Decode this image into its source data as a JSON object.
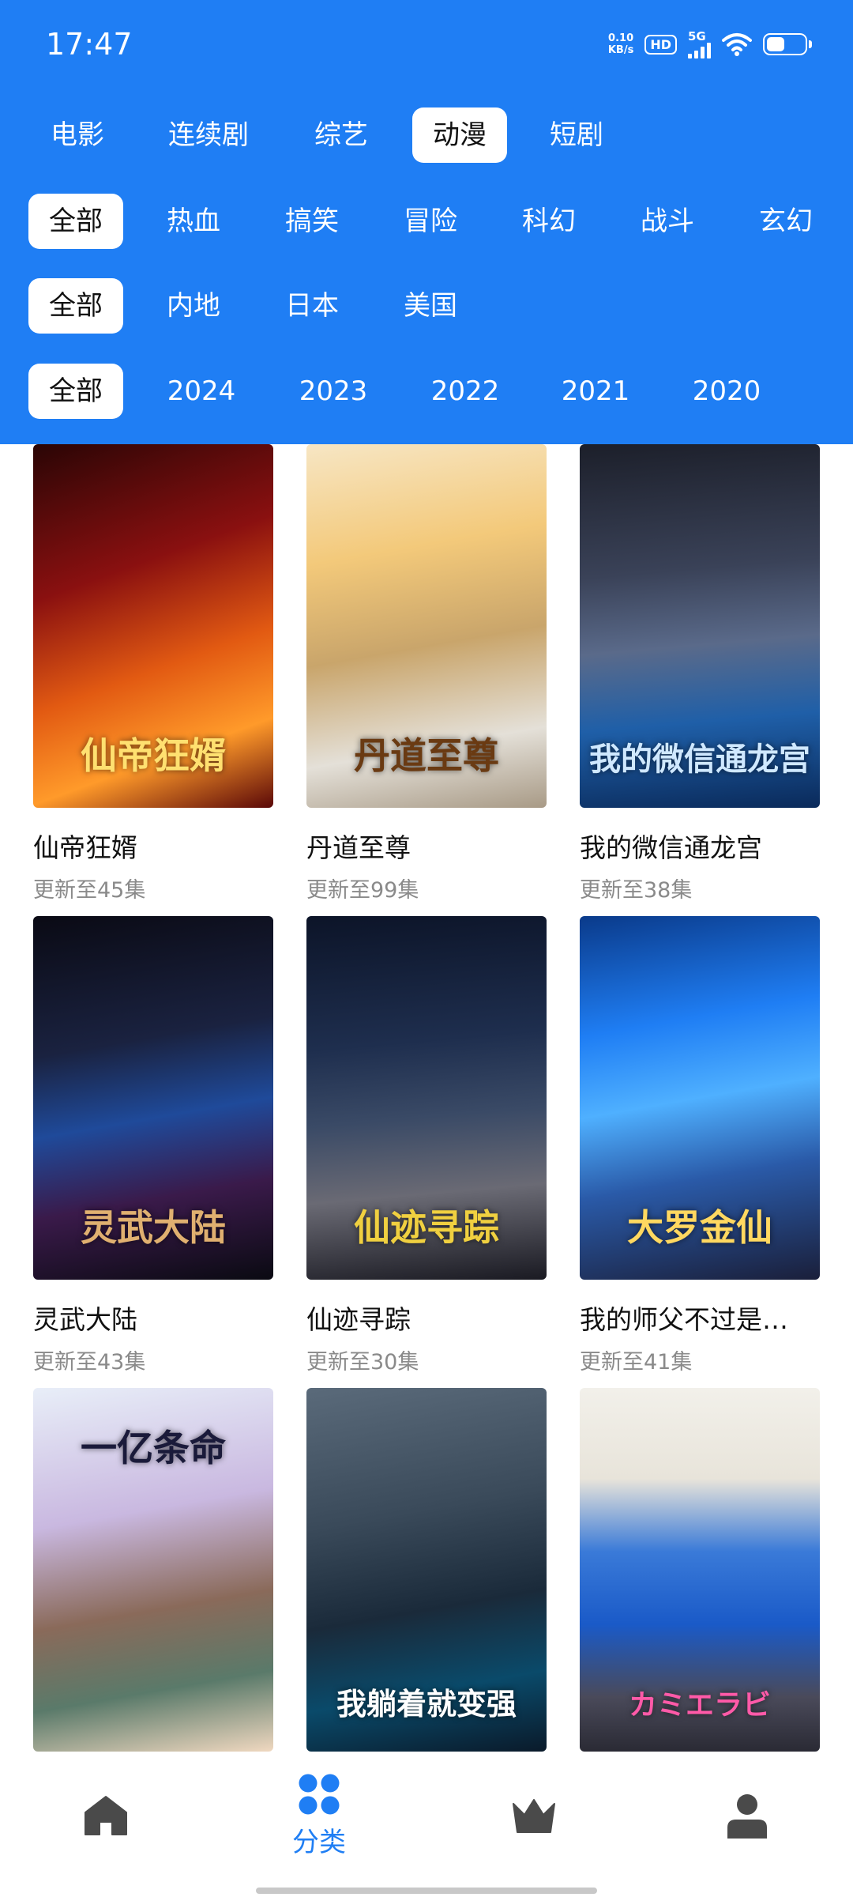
{
  "status_bar": {
    "time": "17:47",
    "net_speed_value": "0.10",
    "net_speed_unit": "KB/s",
    "hd": "HD",
    "network": "5G"
  },
  "category_tabs": [
    "电影",
    "连续剧",
    "综艺",
    "动漫",
    "短剧"
  ],
  "genre_filters": [
    "全部",
    "热血",
    "搞笑",
    "冒险",
    "科幻",
    "战斗",
    "玄幻"
  ],
  "region_filters": [
    "全部",
    "内地",
    "日本",
    "美国"
  ],
  "year_filters": [
    "全部",
    "2024",
    "2023",
    "2022",
    "2021",
    "2020"
  ],
  "items": [
    {
      "title": "仙帝狂婿",
      "subtitle": "更新至45集",
      "poster_text": "仙帝狂婿"
    },
    {
      "title": "丹道至尊",
      "subtitle": "更新至99集",
      "poster_text": "丹道至尊"
    },
    {
      "title": "我的微信通龙宫",
      "subtitle": "更新至38集",
      "poster_text": "我的微信通龙宫"
    },
    {
      "title": "灵武大陆",
      "subtitle": "更新至43集",
      "poster_text": "灵武大陆"
    },
    {
      "title": "仙迹寻踪",
      "subtitle": "更新至30集",
      "poster_text": "仙迹寻踪"
    },
    {
      "title": "我的师父不过是…",
      "subtitle": "更新至41集",
      "poster_text": "大罗金仙"
    },
    {
      "title": "",
      "subtitle": "",
      "poster_text": "一亿条命"
    },
    {
      "title": "",
      "subtitle": "",
      "poster_text": "我躺着就变强"
    },
    {
      "title": "",
      "subtitle": "",
      "poster_text": "カミエラビ"
    }
  ],
  "bottom_nav": {
    "category_label": "分类"
  },
  "colors": {
    "accent": "#1f7ef4",
    "nav_inactive": "#4a4a4a"
  }
}
